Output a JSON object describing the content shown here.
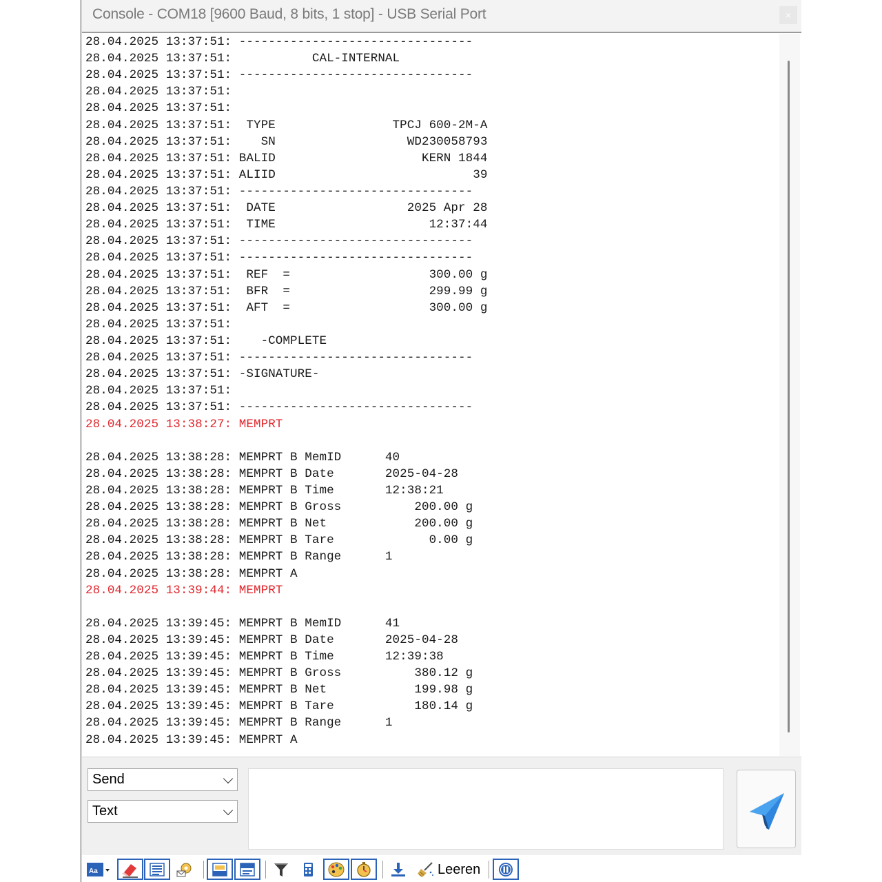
{
  "window": {
    "title": "Console - COM18 [9600 Baud, 8 bits, 1 stop] - USB Serial Port",
    "close_glyph": "×"
  },
  "console": {
    "lines": [
      {
        "text": "28.04.2025 13:37:51: --------------------------------",
        "color": "normal"
      },
      {
        "text": "28.04.2025 13:37:51:           CAL-INTERNAL",
        "color": "normal"
      },
      {
        "text": "28.04.2025 13:37:51: --------------------------------",
        "color": "normal"
      },
      {
        "text": "28.04.2025 13:37:51:",
        "color": "normal"
      },
      {
        "text": "28.04.2025 13:37:51:",
        "color": "normal"
      },
      {
        "text": "28.04.2025 13:37:51:  TYPE                TPCJ 600-2M-A",
        "color": "normal"
      },
      {
        "text": "28.04.2025 13:37:51:    SN                  WD230058793",
        "color": "normal"
      },
      {
        "text": "28.04.2025 13:37:51: BALID                    KERN 1844",
        "color": "normal"
      },
      {
        "text": "28.04.2025 13:37:51: ALIID                           39",
        "color": "normal"
      },
      {
        "text": "28.04.2025 13:37:51: --------------------------------",
        "color": "normal"
      },
      {
        "text": "28.04.2025 13:37:51:  DATE                  2025 Apr 28",
        "color": "normal"
      },
      {
        "text": "28.04.2025 13:37:51:  TIME                     12:37:44",
        "color": "normal"
      },
      {
        "text": "28.04.2025 13:37:51: --------------------------------",
        "color": "normal"
      },
      {
        "text": "28.04.2025 13:37:51: --------------------------------",
        "color": "normal"
      },
      {
        "text": "28.04.2025 13:37:51:  REF  =                   300.00 g",
        "color": "normal"
      },
      {
        "text": "28.04.2025 13:37:51:  BFR  =                   299.99 g",
        "color": "normal"
      },
      {
        "text": "28.04.2025 13:37:51:  AFT  =                   300.00 g",
        "color": "normal"
      },
      {
        "text": "28.04.2025 13:37:51:",
        "color": "normal"
      },
      {
        "text": "28.04.2025 13:37:51:    -COMPLETE",
        "color": "normal"
      },
      {
        "text": "28.04.2025 13:37:51: --------------------------------",
        "color": "normal"
      },
      {
        "text": "28.04.2025 13:37:51: -SIGNATURE-",
        "color": "normal"
      },
      {
        "text": "28.04.2025 13:37:51:",
        "color": "normal"
      },
      {
        "text": "28.04.2025 13:37:51: --------------------------------",
        "color": "normal"
      },
      {
        "text": "28.04.2025 13:38:27: MEMPRT",
        "color": "red"
      },
      {
        "text": "",
        "color": "normal"
      },
      {
        "text": "28.04.2025 13:38:28: MEMPRT B MemID      40",
        "color": "normal"
      },
      {
        "text": "28.04.2025 13:38:28: MEMPRT B Date       2025-04-28",
        "color": "normal"
      },
      {
        "text": "28.04.2025 13:38:28: MEMPRT B Time       12:38:21",
        "color": "normal"
      },
      {
        "text": "28.04.2025 13:38:28: MEMPRT B Gross          200.00 g",
        "color": "normal"
      },
      {
        "text": "28.04.2025 13:38:28: MEMPRT B Net            200.00 g",
        "color": "normal"
      },
      {
        "text": "28.04.2025 13:38:28: MEMPRT B Tare             0.00 g",
        "color": "normal"
      },
      {
        "text": "28.04.2025 13:38:28: MEMPRT B Range      1",
        "color": "normal"
      },
      {
        "text": "28.04.2025 13:38:28: MEMPRT A",
        "color": "normal"
      },
      {
        "text": "28.04.2025 13:39:44: MEMPRT",
        "color": "red"
      },
      {
        "text": "",
        "color": "normal"
      },
      {
        "text": "28.04.2025 13:39:45: MEMPRT B MemID      41",
        "color": "normal"
      },
      {
        "text": "28.04.2025 13:39:45: MEMPRT B Date       2025-04-28",
        "color": "normal"
      },
      {
        "text": "28.04.2025 13:39:45: MEMPRT B Time       12:39:38",
        "color": "normal"
      },
      {
        "text": "28.04.2025 13:39:45: MEMPRT B Gross          380.12 g",
        "color": "normal"
      },
      {
        "text": "28.04.2025 13:39:45: MEMPRT B Net            199.98 g",
        "color": "normal"
      },
      {
        "text": "28.04.2025 13:39:45: MEMPRT B Tare           180.14 g",
        "color": "normal"
      },
      {
        "text": "28.04.2025 13:39:45: MEMPRT B Range      1",
        "color": "normal"
      },
      {
        "text": "28.04.2025 13:39:45: MEMPRT A",
        "color": "normal"
      }
    ]
  },
  "send_panel": {
    "mode_select": "Send",
    "format_select": "Text",
    "input_value": ""
  },
  "toolbar": {
    "clear_label": "Leeren",
    "icons": [
      "font-icon",
      "eraser-icon",
      "text-lines-icon",
      "scroll-settings-icon",
      "dock-bottom-icon",
      "dock-top-icon",
      "filter-icon",
      "calculator-icon",
      "palette-icon",
      "timer-icon",
      "download-icon",
      "clear-broom-icon",
      "pause-icon"
    ]
  },
  "colors": {
    "accent_blue": "#2b63b8",
    "error_red": "#e0282e",
    "send_plane": "#2f86de"
  }
}
